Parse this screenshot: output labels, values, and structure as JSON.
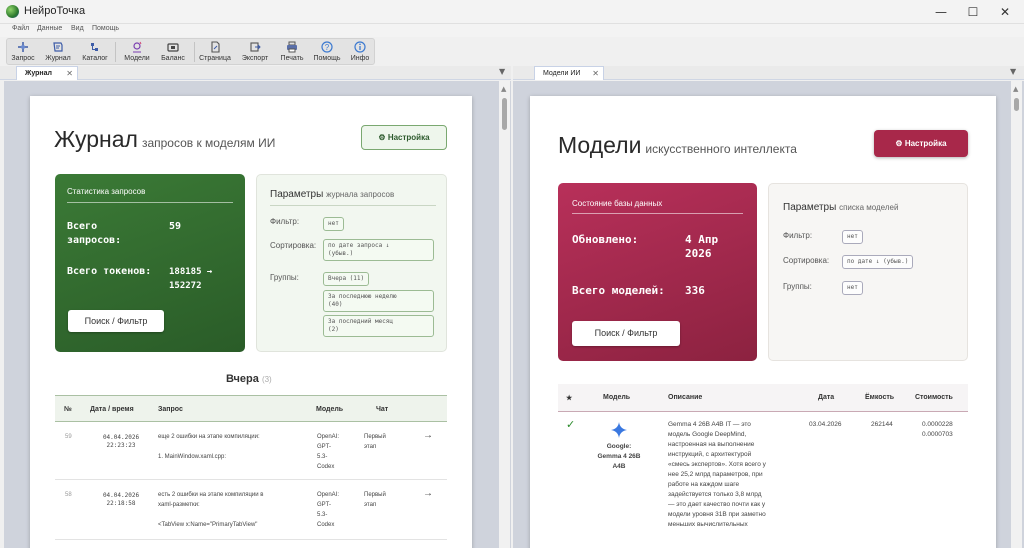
{
  "window": {
    "title": "НейроТочка",
    "minimize": "—",
    "maximize": "☐",
    "close": "✕"
  },
  "menu": {
    "items": [
      "Файл",
      "Данные",
      "Вид",
      "Помощь"
    ]
  },
  "toolbar": {
    "items": [
      "Запрос",
      "Журнал",
      "Каталог",
      "Модели",
      "Баланс",
      "Страница",
      "Экспорт",
      "Печать",
      "Помощь",
      "Инфо"
    ]
  },
  "tabs": {
    "left": {
      "label": "Журнал",
      "close": "✕"
    },
    "right": {
      "label": "Модели ИИ",
      "close": "✕"
    },
    "dropdown": "▼"
  },
  "journal": {
    "title": "Журнал",
    "subtitle": "запросов к моделям ИИ",
    "settings_button": "⚙ Настройка",
    "stats": {
      "title": "Статистика запросов",
      "total_requests_label": "Всего\nзапросов:",
      "total_requests": "59",
      "total_tokens_label": "Всего токенов:",
      "total_tokens": "188185 →\n152272",
      "search_button": "Поиск / Фильтр"
    },
    "params": {
      "title": "Параметры",
      "title_sub": "журнала запросов",
      "filter_label": "Фильтр:",
      "filter_value": "нет",
      "sort_label": "Сортировка:",
      "sort_value": "по дате запроса ↓\n(убыв.)",
      "groups_label": "Группы:",
      "groups": [
        "Вчера (11)",
        "За последнюю неделю\n(40)",
        "За последний месяц\n(2)"
      ]
    },
    "section": {
      "title": "Вчера",
      "count": "(3)"
    },
    "table": {
      "headers": [
        "№",
        "Дата / время",
        "Запрос",
        "Модель",
        "Чат"
      ],
      "rows": [
        {
          "num": "59",
          "datetime": "04.04.2026\n22:23:23",
          "request": "еще 2 ошибки на этапе компиляции:\n\n1. MainWindow.xaml.cpp:",
          "model": "OpenAI:\nGPT-\n5.3-\nCodex",
          "chat": "Первый\nэтап",
          "arrow": "→"
        },
        {
          "num": "58",
          "datetime": "04.04.2026\n22:18:58",
          "request": "есть 2 ошибки на этапе компиляции в\nxaml-разметки:\n\n<TabView x:Name=\"PrimaryTabView\"",
          "model": "OpenAI:\nGPT-\n5.3-\nCodex",
          "chat": "Первый\nэтап",
          "arrow": "→"
        }
      ]
    }
  },
  "models": {
    "title": "Модели",
    "subtitle": "искусственного интеллекта",
    "settings_button": "⚙ Настройка",
    "db": {
      "title": "Состояние базы данных",
      "updated_label": "Обновлено:",
      "updated_value": "4 Апр\n2026",
      "total_label": "Всего моделей:",
      "total_value": "336",
      "search_button": "Поиск / Фильтр"
    },
    "params": {
      "title": "Параметры",
      "title_sub": "списка моделей",
      "filter_label": "Фильтр:",
      "filter_value": "нет",
      "sort_label": "Сортировка:",
      "sort_value": "по дате ↓ (убыв.)",
      "groups_label": "Группы:",
      "groups_value": "нет"
    },
    "table": {
      "headers": [
        "★",
        "Модель",
        "Описание",
        "Дата",
        "Ёмкость",
        "Стоимость"
      ],
      "rows": [
        {
          "star": "✓",
          "model": "Google:\nGemma 4 26B\nA4B",
          "description": "Gemma 4 26B A4B IT — это\nмодель Google DeepMind,\nнастроенная на выполнение\nинструкций, с архитектурой\n«смесь экспертов». Хотя всего у\nнее 25,2 млрд параметров, при\nработе на каждом шаге\nзадействуется только 3,8 млрд\n— это дает качество почти как у\nмодели уровня 31B при заметно\nменьших вычислительных",
          "date": "03.04.2026",
          "capacity": "262144",
          "cost": "0.0000228\n0.0000703"
        }
      ]
    }
  },
  "colors": {
    "green": "#2f6e2f",
    "crimson": "#a8284a",
    "accent": "#8a2a46"
  }
}
